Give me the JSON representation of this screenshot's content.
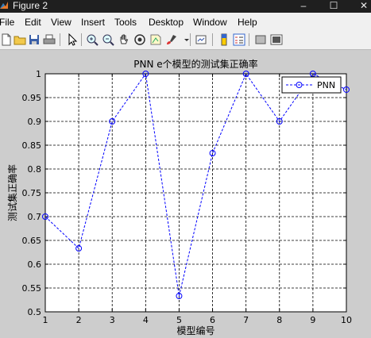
{
  "window": {
    "title": "Figure 2",
    "controls": {
      "minimize": "–",
      "maximize": "☐",
      "close": "✕"
    }
  },
  "menu": [
    "File",
    "Edit",
    "View",
    "Insert",
    "Tools",
    "Desktop",
    "Window",
    "Help"
  ],
  "toolbar": {
    "icons": [
      "new-file-icon",
      "open-folder-icon",
      "save-icon",
      "print-icon",
      "pointer-icon",
      "zoom-in-icon",
      "zoom-out-icon",
      "pan-hand-icon",
      "rotate-3d-icon",
      "data-cursor-icon",
      "brush-icon",
      "brush-dropdown-icon",
      "link-plot-icon",
      "colorbar-icon",
      "legend-icon",
      "hide-plot-tools-icon",
      "show-plot-tools-icon"
    ]
  },
  "colors": {
    "series": "#0000ff",
    "figure_bg": "#cdcdcd",
    "axes_bg": "#ffffff"
  },
  "chart_data": {
    "type": "line",
    "title": "PNN e个模型的测试集正确率",
    "xlabel": "模型编号",
    "ylabel": "测试集正确率",
    "x": [
      1,
      2,
      3,
      4,
      5,
      6,
      7,
      8,
      9,
      10
    ],
    "xlim": [
      1,
      10
    ],
    "ylim": [
      0.5,
      1
    ],
    "xticks": [
      1,
      2,
      3,
      4,
      5,
      6,
      7,
      8,
      9,
      10
    ],
    "yticks": [
      0.5,
      0.55,
      0.6,
      0.65,
      0.7,
      0.75,
      0.8,
      0.85,
      0.9,
      0.95,
      1
    ],
    "ytick_labels": [
      "0.5",
      "0.55",
      "0.6",
      "0.65",
      "0.7",
      "0.75",
      "0.8",
      "0.85",
      "0.9",
      "0.95",
      "1"
    ],
    "grid": true,
    "legend_position": "top-right",
    "series": [
      {
        "name": "PNN",
        "color": "#0000ff",
        "line_style": "dashed",
        "marker": "circle",
        "values": [
          0.7,
          0.6333,
          0.9,
          1.0,
          0.5333,
          0.8333,
          1.0,
          0.9,
          1.0,
          0.9667
        ]
      }
    ]
  }
}
